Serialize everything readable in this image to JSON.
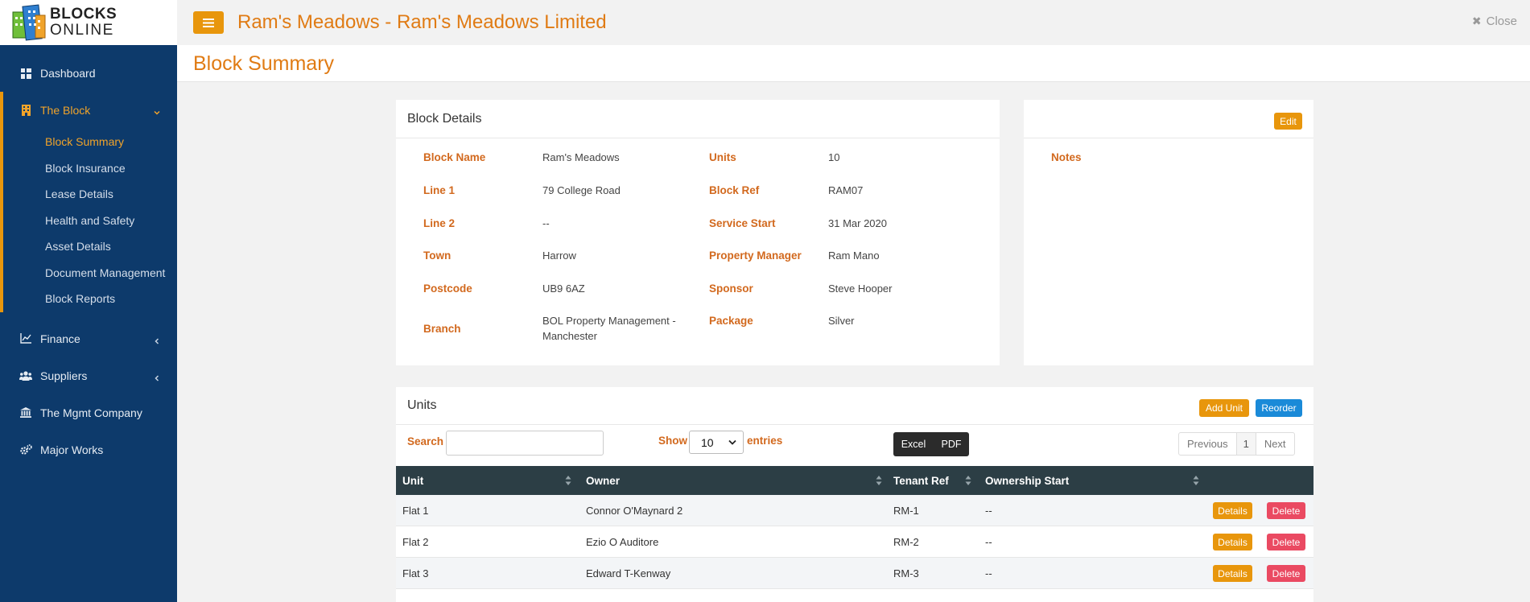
{
  "brand": {
    "line1": "BLOCKS",
    "line2": "ONLINE"
  },
  "header": {
    "title": "Ram's Meadows - Ram's Meadows Limited",
    "close_label": "Close"
  },
  "page_title": "Block Summary",
  "sidebar": {
    "dashboard": "Dashboard",
    "the_block": "The Block",
    "sub_items": [
      "Block Summary",
      "Block Insurance",
      "Lease Details",
      "Health and Safety",
      "Asset Details",
      "Document Management",
      "Block Reports"
    ],
    "finance": "Finance",
    "suppliers": "Suppliers",
    "mgmt_company": "The Mgmt Company",
    "major_works": "Major Works"
  },
  "block_details": {
    "title": "Block Details",
    "block_name_label": "Block Name",
    "block_name": "Ram's Meadows",
    "line1_label": "Line 1",
    "line1": "79 College Road",
    "line2_label": "Line 2",
    "line2": "--",
    "town_label": "Town",
    "town": "Harrow",
    "postcode_label": "Postcode",
    "postcode": "UB9 6AZ",
    "branch_label": "Branch",
    "branch_a": "BOL Property Management -",
    "branch_b": "Manchester",
    "units_label": "Units",
    "units": "10",
    "block_ref_label": "Block Ref",
    "block_ref": "RAM07",
    "service_start_label": "Service Start",
    "service_start": "31 Mar 2020",
    "property_manager_label": "Property Manager",
    "property_manager": "Ram Mano",
    "sponsor_label": "Sponsor",
    "sponsor": "Steve Hooper",
    "package_label": "Package",
    "package": "Silver"
  },
  "notes": {
    "edit_label": "Edit",
    "label": "Notes"
  },
  "units": {
    "title": "Units",
    "add_label": "Add Unit",
    "reorder_label": "Reorder",
    "search_label": "Search",
    "search_value": "",
    "show_label": "Show",
    "entries_value": "10",
    "entries_label": "entries",
    "excel_label": "Excel",
    "pdf_label": "PDF",
    "prev_label": "Previous",
    "page": "1",
    "next_label": "Next",
    "columns": [
      "Unit",
      "Owner",
      "Tenant Ref",
      "Ownership Start"
    ],
    "rows": [
      [
        "Flat 1",
        "Connor O'Maynard 2",
        "RM-1",
        "--"
      ],
      [
        "Flat 2",
        "Ezio O Auditore",
        "RM-2",
        "--"
      ],
      [
        "Flat 3",
        "Edward T-Kenway",
        "RM-3",
        "--"
      ]
    ],
    "details_label": "Details",
    "delete_label": "Delete"
  },
  "colors": {
    "sidebar": "#0d3a6b",
    "accent": "#e8960c",
    "title": "#e07b14",
    "table_head": "#2c3e45",
    "delete": "#ea4a62",
    "reorder": "#1a8ad8"
  }
}
